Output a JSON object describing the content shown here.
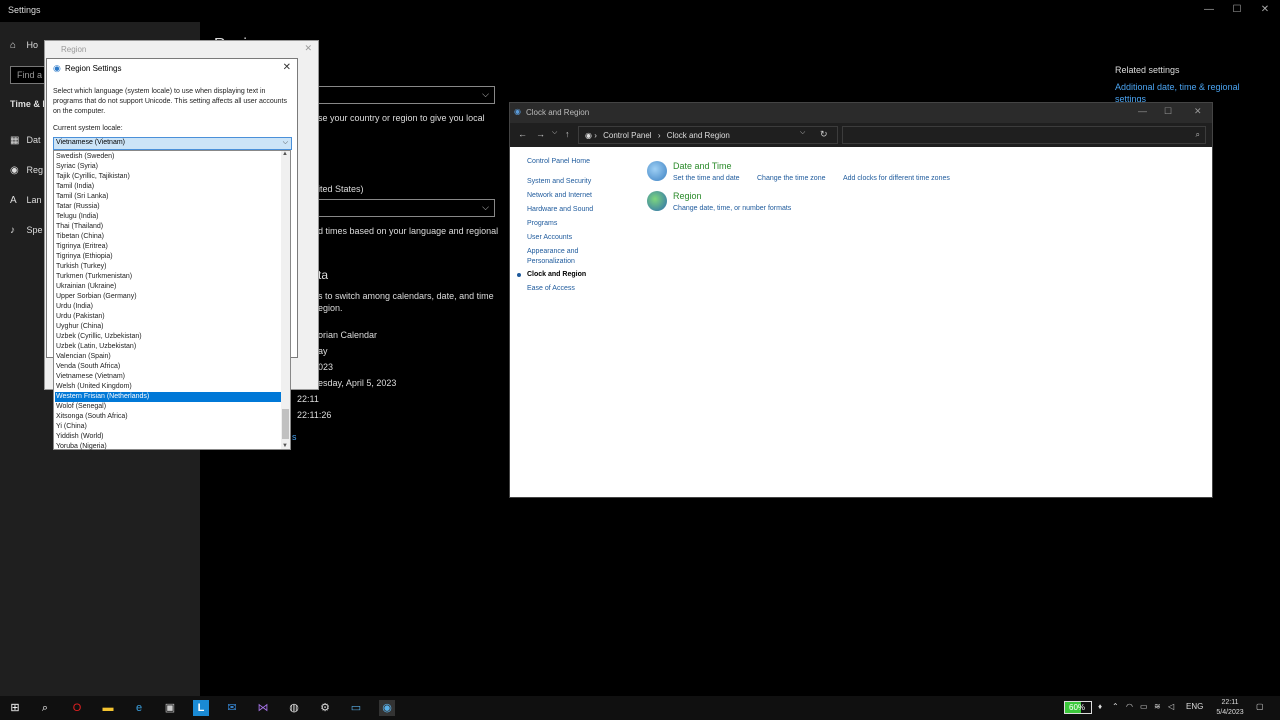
{
  "settings": {
    "title": "Settings",
    "nav": {
      "home": "Ho",
      "search_placeholder": "Find a",
      "section": "Time & L",
      "items": [
        "Dat",
        "Reg",
        "Lan",
        "Spe"
      ]
    },
    "main": {
      "heading": "Region",
      "country_desc": "se your country or region to give you local",
      "format_value": "ited States)",
      "format_desc": "d times based on your language and regional",
      "data_heading": "ta",
      "data_desc1": "s to switch among calendars, date, and time",
      "data_desc2": "egion.",
      "calendar": "orian Calendar",
      "first_day": "ay",
      "short_date": "023",
      "long_date": "esday, April 5, 2023",
      "short_time": "22:11",
      "long_time": "22:11:26",
      "change_link": "s",
      "related_title": "Related settings",
      "related_link1": "Additional date, time & regional",
      "related_link2": "settings"
    },
    "caption": {
      "min": "—",
      "max": "☐",
      "close": "✕"
    }
  },
  "region_dialog": {
    "title": "Region",
    "close": "✕"
  },
  "region_settings": {
    "title": "Region Settings",
    "close": "✕",
    "description": "Select which language (system locale) to use when displaying text in programs that do not support Unicode. This setting affects all user accounts on the computer.",
    "current_label": "Current system locale:",
    "current_value": "Vietnamese (Vietnam)",
    "options": [
      "Swedish (Sweden)",
      "Syriac (Syria)",
      "Tajik (Cyrillic, Tajikistan)",
      "Tamil (India)",
      "Tamil (Sri Lanka)",
      "Tatar (Russia)",
      "Telugu (India)",
      "Thai (Thailand)",
      "Tibetan (China)",
      "Tigrinya (Eritrea)",
      "Tigrinya (Ethiopia)",
      "Turkish (Turkey)",
      "Turkmen (Turkmenistan)",
      "Ukrainian (Ukraine)",
      "Upper Sorbian (Germany)",
      "Urdu (India)",
      "Urdu (Pakistan)",
      "Uyghur (China)",
      "Uzbek (Cyrillic, Uzbekistan)",
      "Uzbek (Latin, Uzbekistan)",
      "Valencian (Spain)",
      "Venda (South Africa)",
      "Vietnamese (Vietnam)",
      "Welsh (United Kingdom)",
      "Western Frisian (Netherlands)",
      "Wolof (Senegal)",
      "Xitsonga (South Africa)",
      "Yi (China)",
      "Yiddish (World)",
      "Yoruba (Nigeria)"
    ],
    "highlighted_option": "Western Frisian (Netherlands)"
  },
  "clock_region": {
    "title": "Clock and Region",
    "breadcrumb": [
      "Control Panel",
      "Clock and Region"
    ],
    "left_nav": [
      {
        "label": "Control Panel Home",
        "active": false
      },
      {
        "label": "System and Security",
        "active": false
      },
      {
        "label": "Network and Internet",
        "active": false
      },
      {
        "label": "Hardware and Sound",
        "active": false
      },
      {
        "label": "Programs",
        "active": false
      },
      {
        "label": "User Accounts",
        "active": false
      },
      {
        "label": "Appearance and",
        "active": false
      },
      {
        "label": "Personalization",
        "active": false
      },
      {
        "label": "Clock and Region",
        "active": true
      },
      {
        "label": "Ease of Access",
        "active": false
      }
    ],
    "categories": [
      {
        "title": "Date and Time",
        "links": [
          "Set the time and date",
          "Change the time zone",
          "Add clocks for different time zones"
        ]
      },
      {
        "title": "Region",
        "links": [
          "Change date, time, or number formats"
        ]
      }
    ]
  },
  "taskbar": {
    "battery_percent": "60%",
    "battery_level": 0.6,
    "language": "ENG",
    "time": "22:11",
    "date": "5/4/2023"
  }
}
